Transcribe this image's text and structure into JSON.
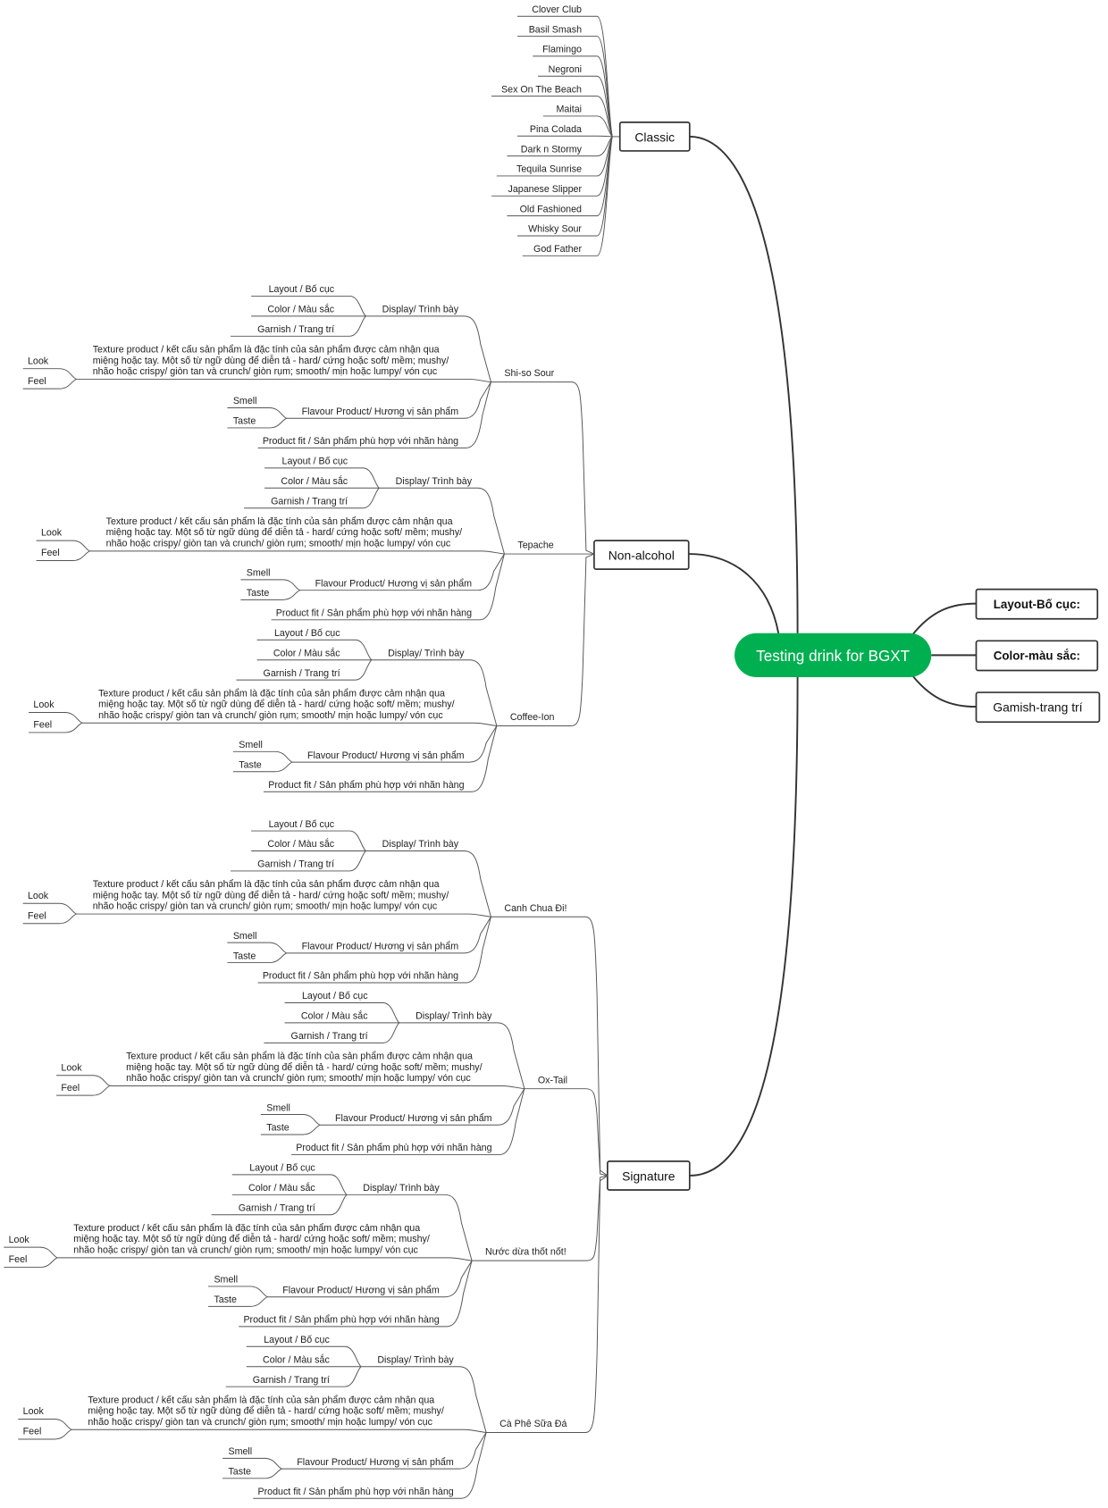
{
  "root": {
    "label": "Testing drink for BGXT",
    "color": "#00b050"
  },
  "right_topics": [
    {
      "label": "Layout-Bố cục:",
      "bold": true
    },
    {
      "label": "Color-màu sắc:",
      "bold": true
    },
    {
      "label": "Gamish-trang trí",
      "bold": false
    }
  ],
  "classic": {
    "label": "Classic",
    "items": [
      "Clover Club",
      "Basil Smash",
      "Flamingo",
      "Negroni",
      "Sex On The Beach",
      "Maitai",
      "Pina Colada",
      "Dark n Stormy",
      "Tequila Sunrise",
      "Japanese Slipper",
      "Old Fashioned",
      "Whisky Sour",
      "God Father"
    ]
  },
  "non_alcohol": {
    "label": "Non-alcohol",
    "drinks": [
      "Shi-so Sour",
      "Tepache",
      "Coffee-Ion"
    ]
  },
  "signature": {
    "label": "Signature",
    "drinks": [
      "Canh Chua Đi!",
      "Ox-Tail",
      "Nước dừa thốt nốt!",
      "Cà Phê Sữa Đá"
    ]
  },
  "criteria": {
    "display": {
      "label": "Display/ Trình bày",
      "items": [
        "Layout / Bố cục",
        "Color / Màu sắc",
        "Garnish / Trang trí"
      ]
    },
    "texture": {
      "lines": [
        "Texture product / kết cấu sản phẩm là đặc tính của sản phẩm được cảm nhận qua",
        "miệng hoặc tay. Một số từ ngữ dùng để diễn tả - hard/ cứng hoặc soft/ mềm; mushy/",
        "nhão hoặc crispy/ giòn tan và crunch/ giòn rụm; smooth/ mịn  hoặc lumpy/ vón cục"
      ],
      "items": [
        "Look",
        "Feel"
      ]
    },
    "flavour": {
      "label": "Flavour Product/ Hương vị sản phẩm",
      "items": [
        "Smell",
        "Taste"
      ]
    },
    "product_fit": {
      "label": "Product fit / Sản phẩm phù hợp với nhãn hàng"
    }
  }
}
